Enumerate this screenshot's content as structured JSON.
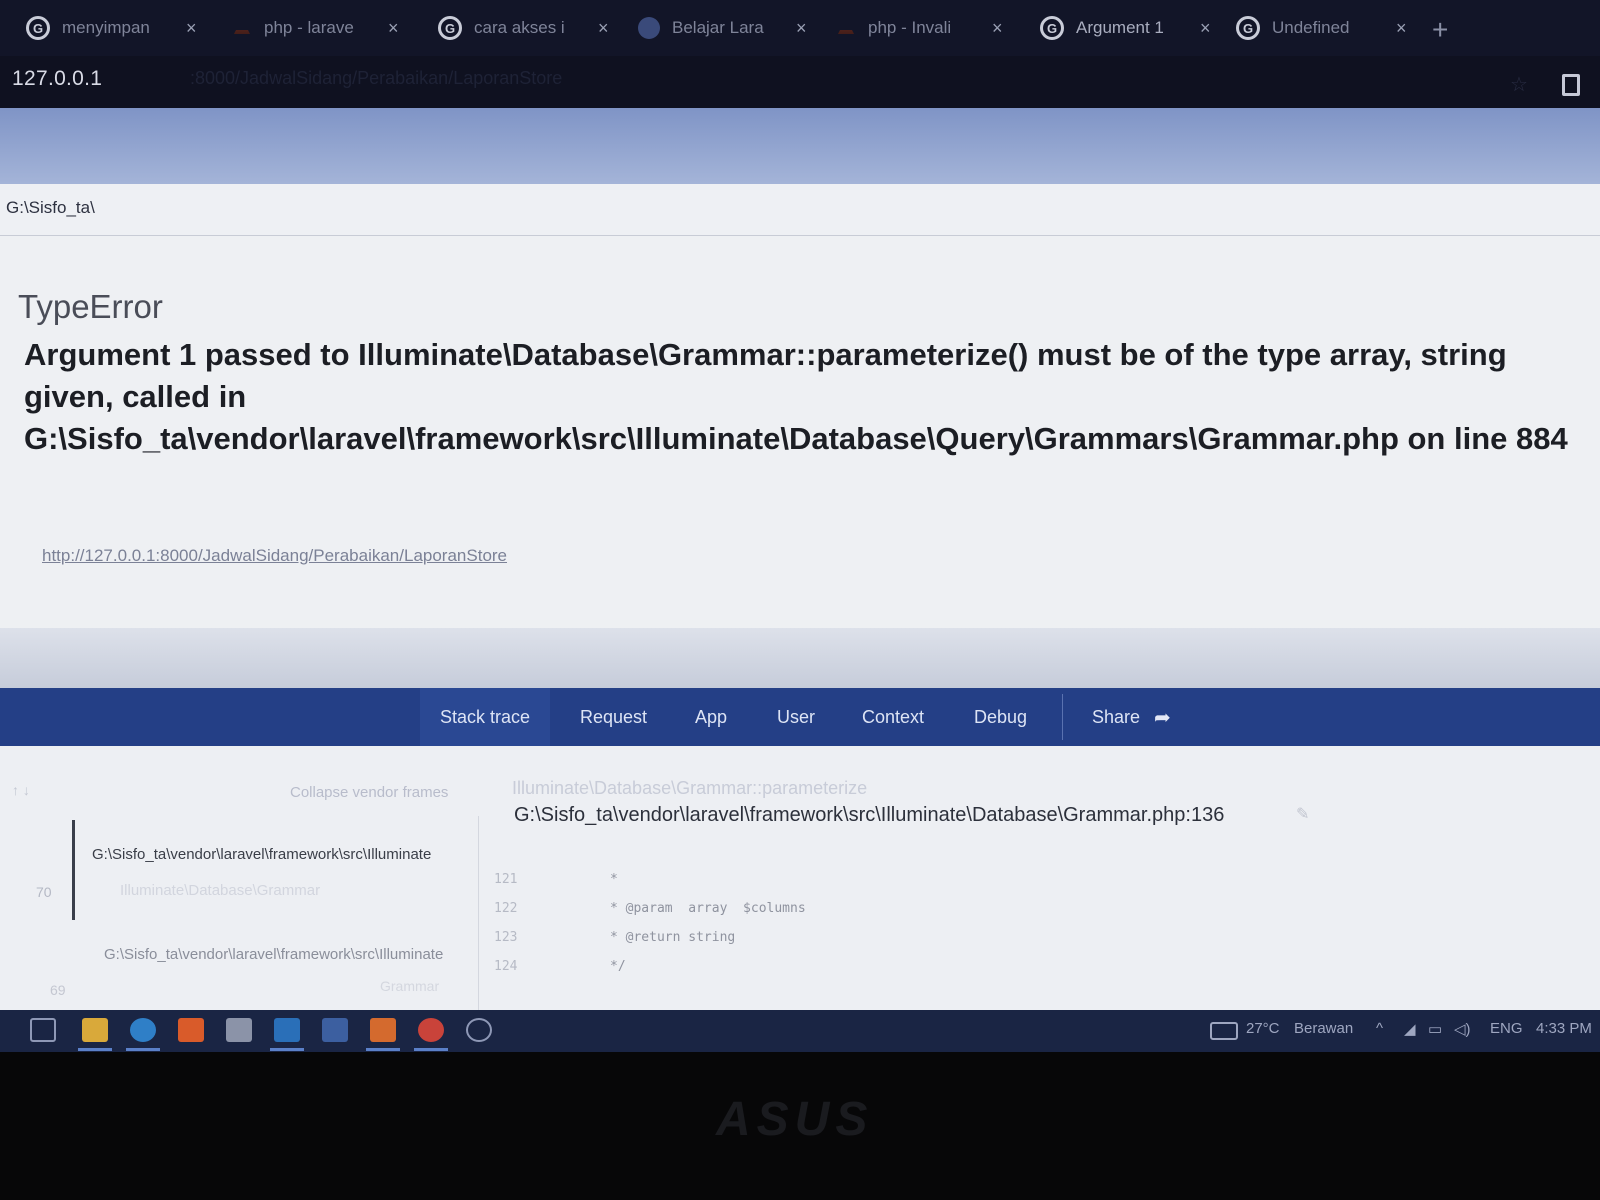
{
  "browser": {
    "tabs": [
      {
        "title": "menyimpan",
        "icon": "google-icon"
      },
      {
        "title": "php - larave",
        "icon": "stackoverflow-icon"
      },
      {
        "title": "cara akses i",
        "icon": "google-icon"
      },
      {
        "title": "Belajar Lara",
        "icon": "globe-icon"
      },
      {
        "title": "php - Invali",
        "icon": "stackoverflow-icon"
      },
      {
        "title": "Argument 1",
        "icon": "google-icon"
      },
      {
        "title": "Undefined",
        "icon": "google-icon"
      }
    ],
    "close_glyph": "×",
    "new_tab_glyph": "+",
    "address": "127.0.0.1",
    "address_rest": ":8000/JadwalSidang/Perabaikan/LaporanStore"
  },
  "page": {
    "path": "G:\\Sisfo_ta\\",
    "error_type": "TypeError",
    "error_message": "Argument 1 passed to Illuminate\\Database\\Grammar::parameterize() must be of the type array, string given, called in G:\\Sisfo_ta\\vendor\\laravel\\framework\\src\\Illuminate\\Database\\Query\\Grammars\\Grammar.php on line 884",
    "error_url": "http://127.0.0.1:8000/JadwalSidang/Perabaikan/LaporanStore"
  },
  "tabs_nav": {
    "stack_trace": "Stack trace",
    "request": "Request",
    "app": "App",
    "user": "User",
    "context": "Context",
    "debug": "Debug",
    "share": "Share"
  },
  "trace": {
    "collapse_label": "Collapse vendor frames",
    "function_name": "Illuminate\\Database\\Grammar::parameterize",
    "file_path": "G:\\Sisfo_ta\\vendor\\laravel\\framework\\src\\Illuminate\\Database\\Grammar.php:136",
    "frames": [
      {
        "number": "70",
        "file": "G:\\Sisfo_ta\\vendor\\laravel\\framework\\src\\Illuminate",
        "sub": "Illuminate\\Database\\Grammar"
      },
      {
        "number": "69",
        "file": "G:\\Sisfo_ta\\vendor\\laravel\\framework\\src\\Illuminate",
        "sub": "Grammar"
      }
    ],
    "code_lines": [
      {
        "line": "121",
        "text": "*"
      },
      {
        "line": "122",
        "text": "* @param  array  $columns"
      },
      {
        "line": "123",
        "text": "* @return string"
      },
      {
        "line": "124",
        "text": "*/"
      }
    ]
  },
  "taskbar": {
    "temperature": "27°C",
    "weather": "Berawan",
    "language": "ENG",
    "time": "4:33 PM"
  },
  "bezel_brand": "ASUS"
}
